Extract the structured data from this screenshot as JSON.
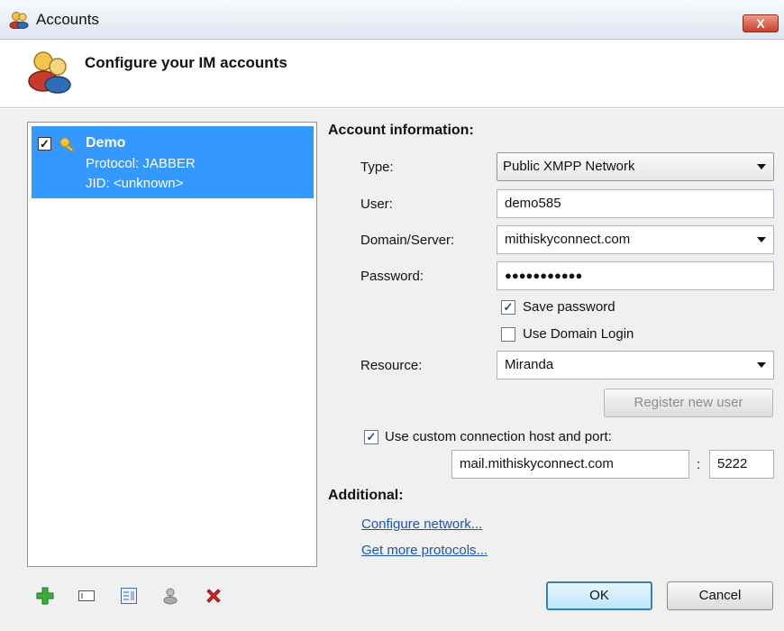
{
  "window": {
    "title": "Accounts",
    "close_label": "X"
  },
  "header": {
    "title": "Configure your IM accounts"
  },
  "accounts": [
    {
      "name": "Demo",
      "protocol": "Protocol: JABBER",
      "jid": "JID: <unknown>",
      "checked": true
    }
  ],
  "account_info": {
    "section_title": "Account information:",
    "type_label": "Type:",
    "type_value": "Public XMPP Network",
    "user_label": "User:",
    "user_value": "demo585",
    "domain_label": "Domain/Server:",
    "domain_value": "mithiskyconnect.com",
    "password_label": "Password:",
    "password_value": "●●●●●●●●●●●",
    "save_password_label": "Save password",
    "save_password_checked": true,
    "use_domain_login_label": "Use Domain Login",
    "use_domain_login_checked": false,
    "resource_label": "Resource:",
    "resource_value": "Miranda",
    "register_label": "Register new user",
    "custom_host_label": "Use custom connection host and port:",
    "custom_host_checked": true,
    "host_value": "mail.mithiskyconnect.com",
    "port_separator": ":",
    "port_value": "5222"
  },
  "additional": {
    "section_title": "Additional:",
    "configure_network": "Configure network...",
    "get_protocols": "Get more protocols..."
  },
  "footer": {
    "ok_label": "OK",
    "cancel_label": "Cancel"
  },
  "colors": {
    "selection": "#3399ff",
    "link": "#1d56b0",
    "close": "#c9412a"
  },
  "icons": [
    "add-account-icon",
    "rename-account-icon",
    "account-options-icon",
    "account-users-icon",
    "delete-account-icon"
  ]
}
